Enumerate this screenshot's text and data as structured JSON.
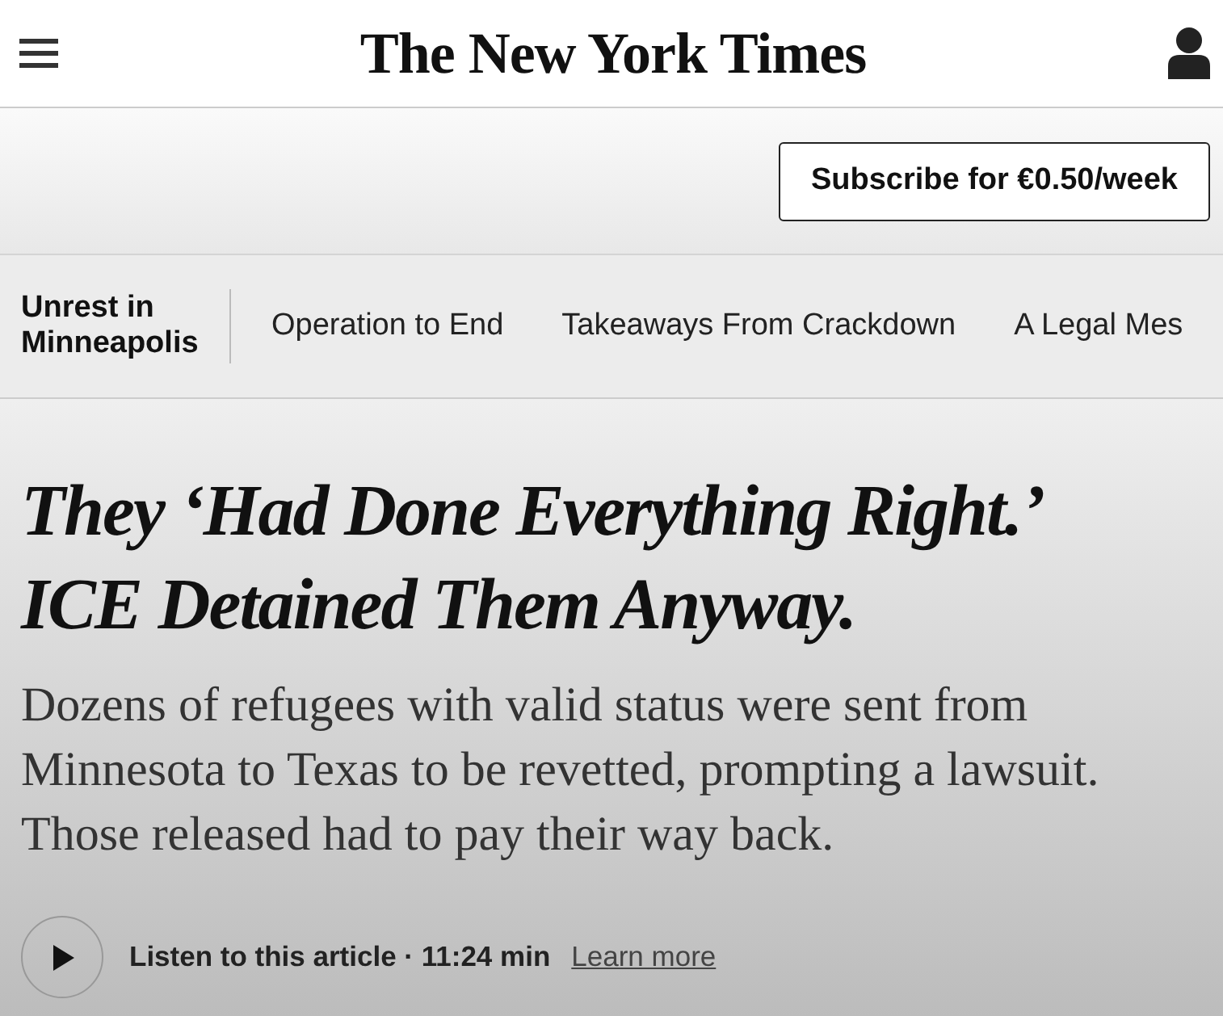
{
  "header": {
    "logo": "The New York Times"
  },
  "subscribe": {
    "label": "Subscribe for €0.50/week"
  },
  "nav": {
    "section": "Unrest in Minneapolis",
    "items": [
      {
        "label": "Operation to End"
      },
      {
        "label": "Takeaways From Crackdown"
      },
      {
        "label": "A Legal Mes"
      }
    ]
  },
  "article": {
    "headline": "They ‘Had Done Everything Right.’ ICE Detained Them Anyway.",
    "summary": "Dozens of refugees with valid status were sent from Minnesota to Texas to be revetted, prompting a lawsuit. Those released had to pay their way back.",
    "listen": "Listen to this article · 11:24 min",
    "learn_more": "Learn more"
  }
}
